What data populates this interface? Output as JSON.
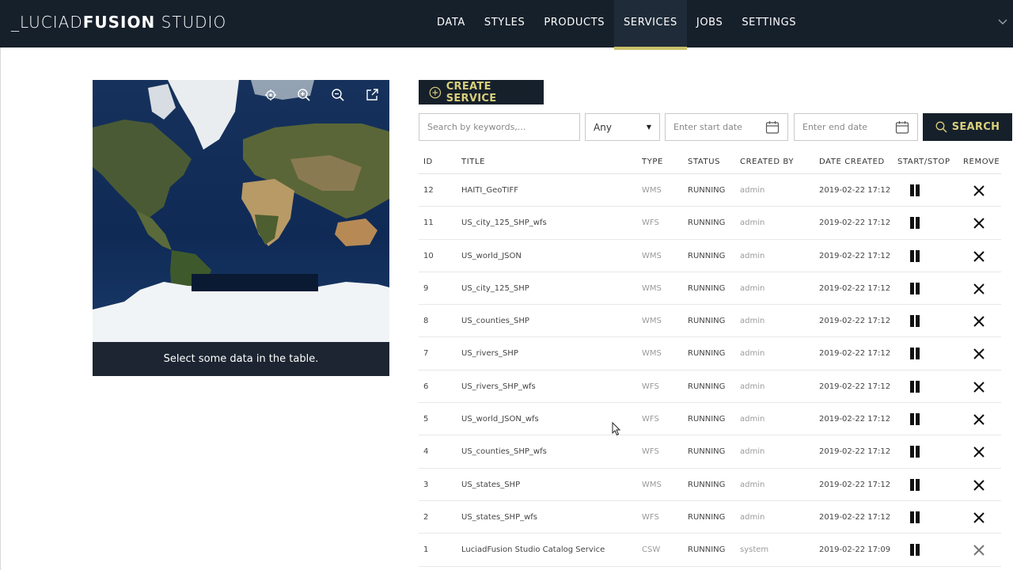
{
  "app": {
    "brand_prefix": "_LUCIAD",
    "brand_bold": "FUSION",
    "brand_suffix": " STUDIO"
  },
  "nav": [
    {
      "label": "DATA",
      "active": false
    },
    {
      "label": "STYLES",
      "active": false
    },
    {
      "label": "PRODUCTS",
      "active": false
    },
    {
      "label": "SERVICES",
      "active": true
    },
    {
      "label": "JOBS",
      "active": false
    },
    {
      "label": "SETTINGS",
      "active": false
    }
  ],
  "map": {
    "caption": "Select some data in the table.",
    "tools": [
      "locate-icon",
      "zoom-in-icon",
      "zoom-out-icon",
      "open-external-icon"
    ]
  },
  "toolbar": {
    "create_label": "CREATE SERVICE",
    "search_placeholder": "Search by keywords,...",
    "type_select_value": "Any",
    "start_date_placeholder": "Enter start date",
    "end_date_placeholder": "Enter end date",
    "search_label": "SEARCH"
  },
  "table": {
    "headers": [
      "ID",
      "TITLE",
      "TYPE",
      "STATUS",
      "CREATED BY",
      "DATE CREATED",
      "START/STOP",
      "REMOVE"
    ],
    "rows": [
      {
        "id": "12",
        "title": "HAITI_GeoTIFF",
        "type": "WMS",
        "status": "RUNNING",
        "created_by": "admin",
        "date": "2019-02-22 17:12"
      },
      {
        "id": "11",
        "title": "US_city_125_SHP_wfs",
        "type": "WFS",
        "status": "RUNNING",
        "created_by": "admin",
        "date": "2019-02-22 17:12"
      },
      {
        "id": "10",
        "title": "US_world_JSON",
        "type": "WMS",
        "status": "RUNNING",
        "created_by": "admin",
        "date": "2019-02-22 17:12"
      },
      {
        "id": "9",
        "title": "US_city_125_SHP",
        "type": "WMS",
        "status": "RUNNING",
        "created_by": "admin",
        "date": "2019-02-22 17:12"
      },
      {
        "id": "8",
        "title": "US_counties_SHP",
        "type": "WMS",
        "status": "RUNNING",
        "created_by": "admin",
        "date": "2019-02-22 17:12"
      },
      {
        "id": "7",
        "title": "US_rivers_SHP",
        "type": "WMS",
        "status": "RUNNING",
        "created_by": "admin",
        "date": "2019-02-22 17:12"
      },
      {
        "id": "6",
        "title": "US_rivers_SHP_wfs",
        "type": "WFS",
        "status": "RUNNING",
        "created_by": "admin",
        "date": "2019-02-22 17:12"
      },
      {
        "id": "5",
        "title": "US_world_JSON_wfs",
        "type": "WFS",
        "status": "RUNNING",
        "created_by": "admin",
        "date": "2019-02-22 17:12"
      },
      {
        "id": "4",
        "title": "US_counties_SHP_wfs",
        "type": "WFS",
        "status": "RUNNING",
        "created_by": "admin",
        "date": "2019-02-22 17:12"
      },
      {
        "id": "3",
        "title": "US_states_SHP",
        "type": "WMS",
        "status": "RUNNING",
        "created_by": "admin",
        "date": "2019-02-22 17:12"
      },
      {
        "id": "2",
        "title": "US_states_SHP_wfs",
        "type": "WFS",
        "status": "RUNNING",
        "created_by": "admin",
        "date": "2019-02-22 17:12"
      },
      {
        "id": "1",
        "title": "LuciadFusion Studio Catalog Service",
        "type": "CSW",
        "status": "RUNNING",
        "created_by": "system",
        "date": "2019-02-22 17:09"
      }
    ]
  },
  "colors": {
    "header_bg": "#16202b",
    "accent": "#d9cf7a",
    "active_underline": "#c9c06a"
  }
}
